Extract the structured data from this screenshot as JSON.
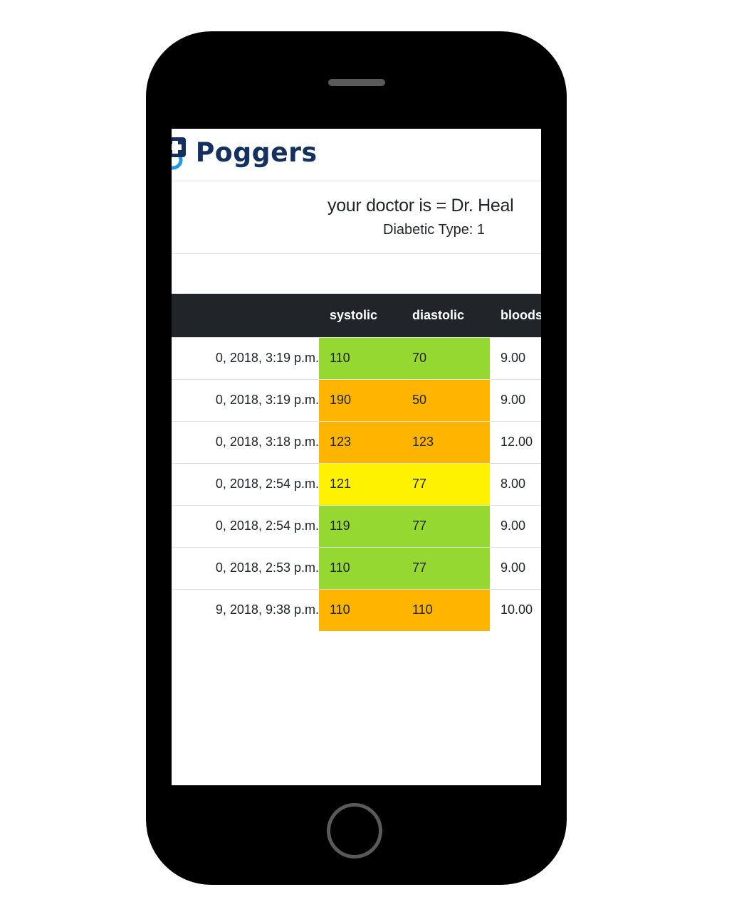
{
  "brand": {
    "name": "Poggers",
    "logo_icon": "medical-cross-icon"
  },
  "header": {
    "doctor_text": "your doctor is = Dr. Heal",
    "diabetic_text": "Diabetic Type: 1"
  },
  "table": {
    "columns": [
      "",
      "systolic",
      "diastolic",
      "bloods"
    ],
    "rows": [
      {
        "date": "0, 2018, 3:19 p.m.",
        "systolic": "110",
        "diastolic": "70",
        "blood": "9.00",
        "status_color": "#95d832"
      },
      {
        "date": "0, 2018, 3:19 p.m.",
        "systolic": "190",
        "diastolic": "50",
        "blood": "9.00",
        "status_color": "#ffb400"
      },
      {
        "date": "0, 2018, 3:18 p.m.",
        "systolic": "123",
        "diastolic": "123",
        "blood": "12.00",
        "status_color": "#ffb400"
      },
      {
        "date": "0, 2018, 2:54 p.m.",
        "systolic": "121",
        "diastolic": "77",
        "blood": "8.00",
        "status_color": "#fff200"
      },
      {
        "date": "0, 2018, 2:54 p.m.",
        "systolic": "119",
        "diastolic": "77",
        "blood": "9.00",
        "status_color": "#95d832"
      },
      {
        "date": "0, 2018, 2:53 p.m.",
        "systolic": "110",
        "diastolic": "77",
        "blood": "9.00",
        "status_color": "#95d832"
      },
      {
        "date": "9, 2018, 9:38 p.m.",
        "systolic": "110",
        "diastolic": "110",
        "blood": "10.00",
        "status_color": "#ffb400"
      }
    ]
  },
  "colors": {
    "brand_navy": "#14305e",
    "brand_blue": "#1e88e5",
    "table_header_bg": "#212529",
    "phone_body": "#000000"
  }
}
